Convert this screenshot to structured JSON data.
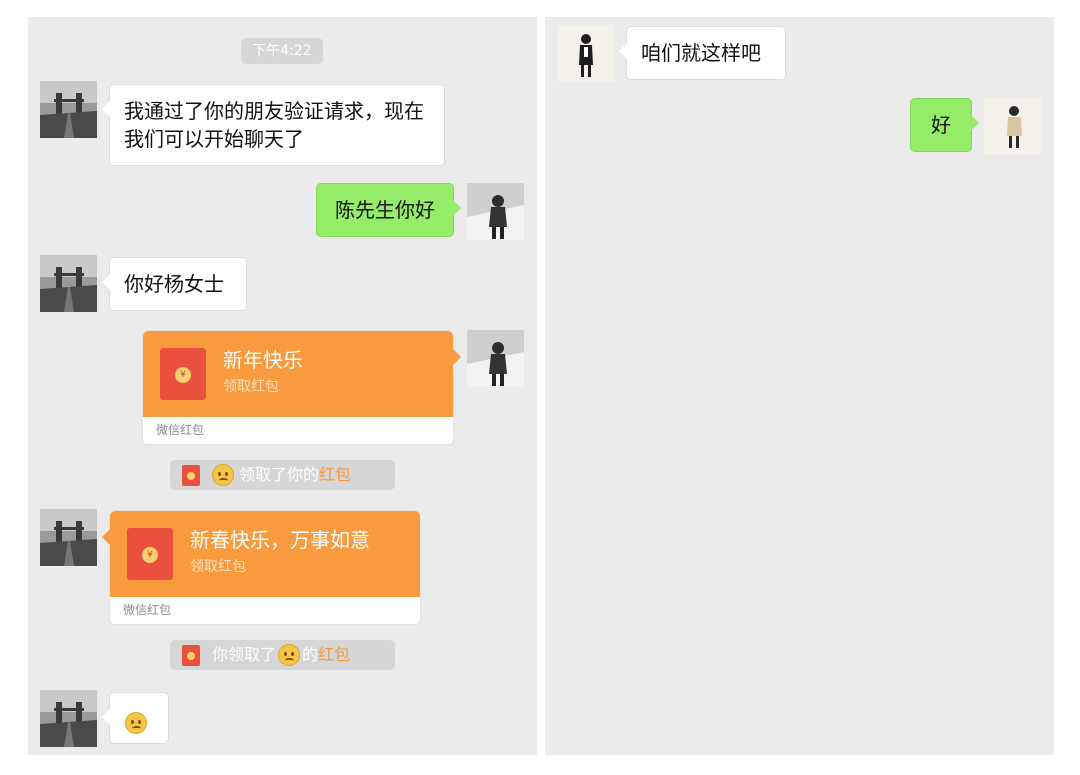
{
  "left_panel": {
    "timestamp": "下午4:22",
    "messages": [
      {
        "side": "received",
        "text": "我通过了你的朋友验证请求，现在我们可以开始聊天了"
      },
      {
        "side": "sent",
        "text": "陈先生你好"
      },
      {
        "side": "received",
        "text": "你好杨女士"
      }
    ],
    "red_packet_sent": {
      "title": "新年快乐",
      "subtitle": "领取红包",
      "footer": "微信红包"
    },
    "notice_1": {
      "text": "领取了你的",
      "highlight": "红包"
    },
    "red_packet_received": {
      "title": "新春快乐，万事如意",
      "subtitle": "领取红包",
      "footer": "微信红包"
    },
    "notice_2": {
      "prefix": "你领取了",
      "suffix": "的",
      "highlight": "红包"
    },
    "last_message": {
      "side": "received",
      "content": "smile-emoji"
    }
  },
  "right_panel": {
    "messages": [
      {
        "side": "received",
        "text": "咱们就这样吧"
      },
      {
        "side": "sent",
        "text": "好"
      }
    ]
  },
  "colors": {
    "chat_bg": "#ebebeb",
    "sent_bubble": "#95ec69",
    "received_bubble": "#ffffff",
    "red_packet": "#f79b3e",
    "highlight": "#f79b3e"
  }
}
